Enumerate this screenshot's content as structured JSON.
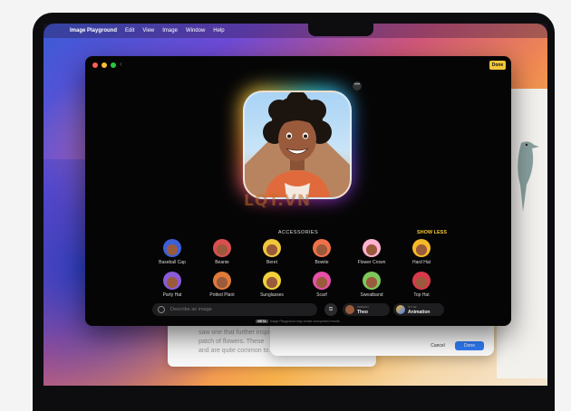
{
  "menu_bar": {
    "app_name": "Image Playground",
    "items": [
      "Edit",
      "View",
      "Image",
      "Window",
      "Help"
    ]
  },
  "window": {
    "done_label": "Done"
  },
  "portrait": {
    "more_label": "•••"
  },
  "watermark": "LQT.VN",
  "accessories": {
    "title": "ACCESSORIES",
    "show_less": "SHOW LESS",
    "items": [
      {
        "label": "Baseball Cap",
        "color": "#3d5fd8"
      },
      {
        "label": "Beanie",
        "color": "#d94f4f"
      },
      {
        "label": "Beret",
        "color": "#f2c63a"
      },
      {
        "label": "Bowtie",
        "color": "#f0704a"
      },
      {
        "label": "Flower Crown",
        "color": "#ffb2d0"
      },
      {
        "label": "Hard Hat",
        "color": "#f7b928"
      },
      {
        "label": "Party Hat",
        "color": "#8a5ad9"
      },
      {
        "label": "Potted Plant",
        "color": "#e07a3a"
      },
      {
        "label": "Sunglasses",
        "color": "#f2d13a"
      },
      {
        "label": "Scarf",
        "color": "#e84fa8"
      },
      {
        "label": "Sweatband",
        "color": "#7cc95a"
      },
      {
        "label": "Top Hat",
        "color": "#d93a4a"
      }
    ]
  },
  "prompt": {
    "placeholder": "Describe an image"
  },
  "person": {
    "caption": "PERSON",
    "name": "Theo"
  },
  "style": {
    "caption": "STYLE",
    "value": "Animation"
  },
  "notice": {
    "badge": "BETA",
    "text": "Image Playground may create unexpected results."
  },
  "background": {
    "doc_lines": [
      "saw one that further inspi...",
      "patch of flowers. These",
      "and are quite common to..."
    ],
    "dialog_cancel": "Cancel",
    "dialog_done": "Done"
  }
}
